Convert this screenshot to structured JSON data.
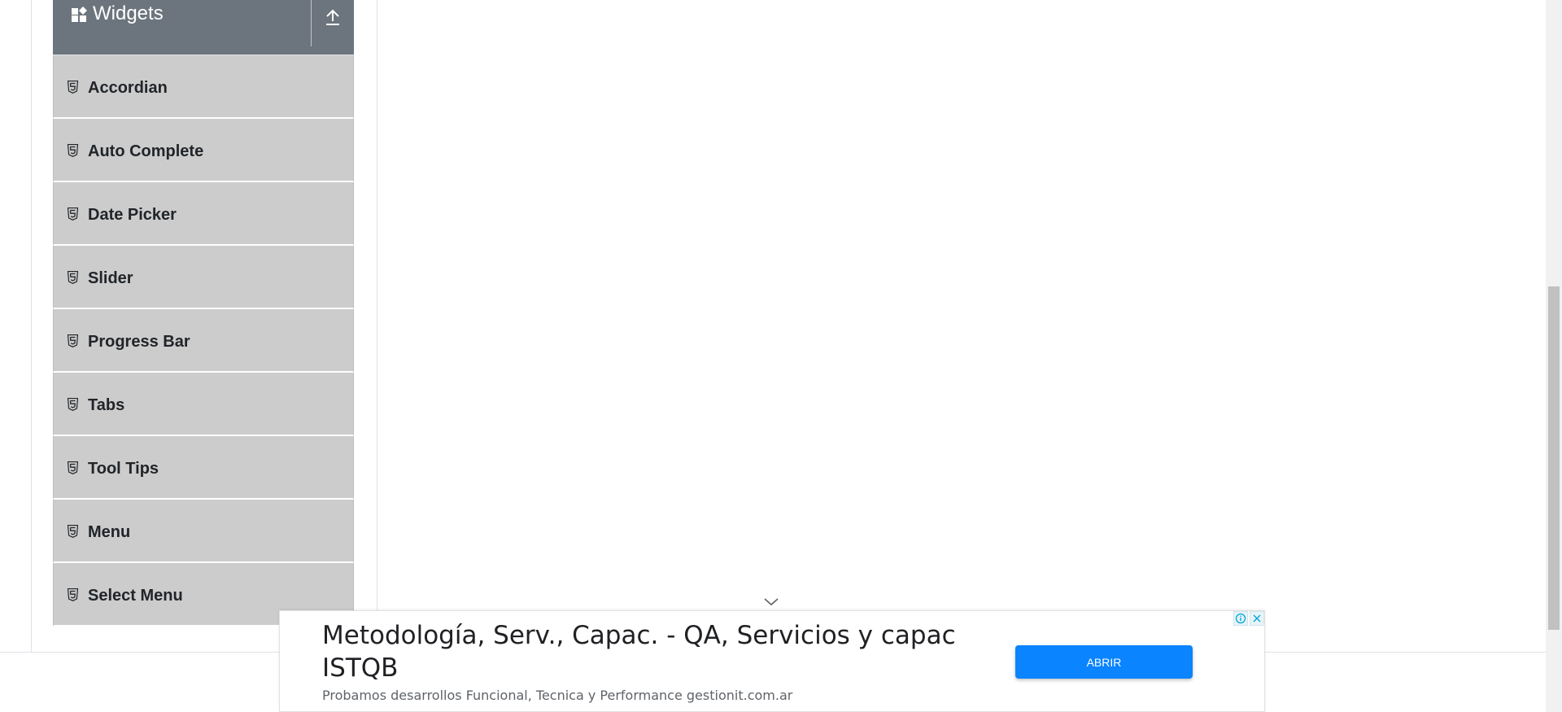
{
  "sidebar": {
    "group": {
      "title": "Widgets",
      "icon": "widgets-icon",
      "collapse_icon": "upload-arrow-icon"
    },
    "items": [
      {
        "label": "Accordian",
        "icon": "html5-icon"
      },
      {
        "label": "Auto Complete",
        "icon": "html5-icon"
      },
      {
        "label": "Date Picker",
        "icon": "html5-icon"
      },
      {
        "label": "Slider",
        "icon": "html5-icon"
      },
      {
        "label": "Progress Bar",
        "icon": "html5-icon"
      },
      {
        "label": "Tabs",
        "icon": "html5-icon"
      },
      {
        "label": "Tool Tips",
        "icon": "html5-icon"
      },
      {
        "label": "Menu",
        "icon": "html5-icon"
      },
      {
        "label": "Select Menu",
        "icon": "html5-icon"
      }
    ]
  },
  "ad": {
    "headline": "Metodología, Serv., Capac. - QA, Servicios y capac ISTQB",
    "description": "Probamos desarrollos Funcional, Tecnica y Performance gestionit.com.ar",
    "cta_label": "ABRIR",
    "cta_color": "#0a84ff",
    "info_icon": "info-icon",
    "close_icon": "close-icon"
  },
  "colors": {
    "group_header_bg": "#6c757d",
    "menu_item_bg": "#cccccc",
    "text_dark": "#212529"
  }
}
